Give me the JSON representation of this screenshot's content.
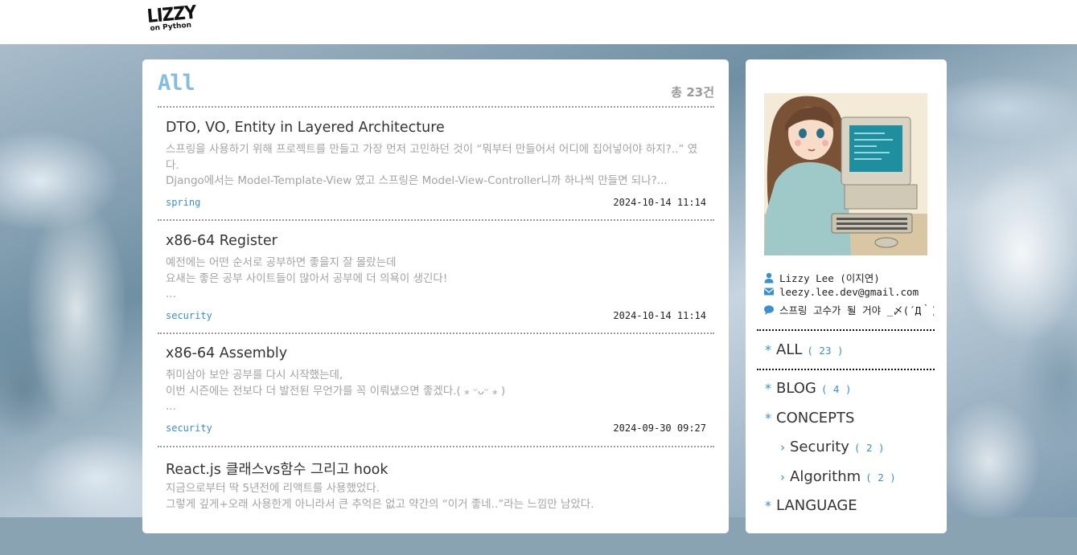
{
  "header": {
    "logo_title": "LIZZY",
    "logo_subtitle": "on Python"
  },
  "main": {
    "title": "All",
    "count_text": "총 23건",
    "posts": [
      {
        "title": "DTO, VO, Entity in Layered Architecture",
        "excerpt": "스프링을 사용하기 위해 프로젝트를 만들고 가장 먼저 고민하던 것이 “뭐부터 만들어서 어디에 집어넣어야 하지?..” 였다.\nDjango에서는 Model-Template-View 였고 스프링은 Model-View-Controller니까 하나씩 만들면 되나?...",
        "tag": "spring",
        "date": "2024-10-14 11:14"
      },
      {
        "title": "x86-64 Register",
        "excerpt": "예전에는 어떤 순서로 공부하면 좋을지 잘 몰랐는데\n요새는 좋은 공부 사이트들이 많아서 공부에 더 의욕이 생긴다!\n...",
        "tag": "security",
        "date": "2024-10-14 11:14"
      },
      {
        "title": "x86-64 Assembly",
        "excerpt": "취미삼아 보안 공부를 다시 시작했는데,\n이번 시즌에는 전보다 더 발전된 무언가를 꼭 이뤄냈으면 좋겠다.( ⁎ ᵕᴗᵕ ⁎ )\n...",
        "tag": "security",
        "date": "2024-09-30 09:27"
      },
      {
        "title": "React.js 클래스vs함수 그리고 hook",
        "excerpt": "지금으로부터 딱 5년전에 리액트를 사용했었다.\n그렇게 깊게+오래 사용한게 아니라서 큰 추억은 없고 약간의 “이거 좋네..”라는 느낌만 남았다.",
        "tag": "",
        "date": ""
      }
    ]
  },
  "sidebar": {
    "profile": {
      "name": "Lizzy Lee (이지연)",
      "email": "leezy.lee.dev@gmail.com",
      "motto": "스프링 고수가 될 거야 _〆(´Д｀)"
    },
    "all": {
      "label": "ALL",
      "count": "( 23 )"
    },
    "categories": [
      {
        "label": "BLOG",
        "count": "( 4 )"
      },
      {
        "label": "CONCEPTS",
        "count": ""
      },
      {
        "label": "Security",
        "count": "( 2 )"
      },
      {
        "label": "Algorithm",
        "count": "( 2 )"
      },
      {
        "label": "LANGUAGE",
        "count": ""
      }
    ]
  },
  "colors": {
    "accent": "#3a8fd0",
    "title": "#84bde0"
  }
}
